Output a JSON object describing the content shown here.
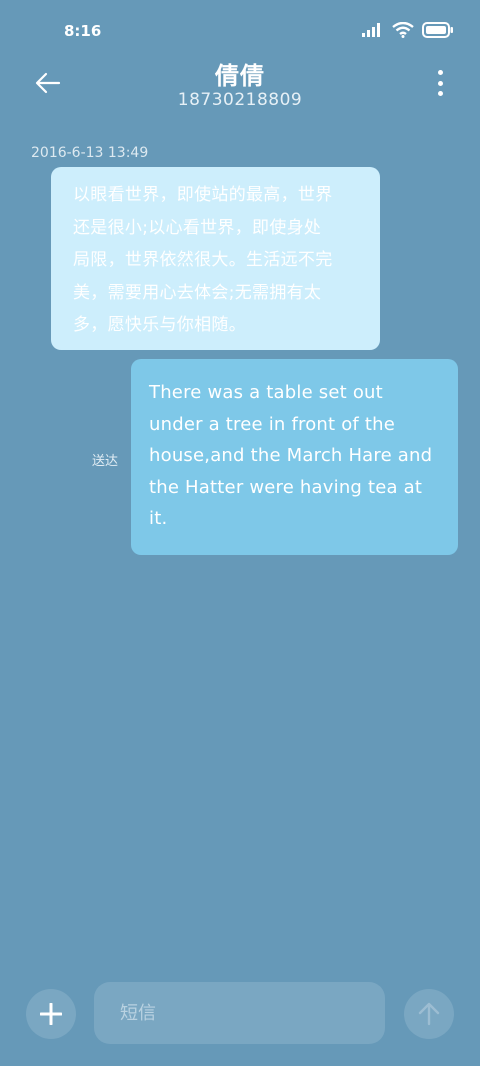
{
  "status_bar": {
    "time": "8:16",
    "icons": [
      "signal-icon",
      "wifi-icon",
      "battery-icon"
    ]
  },
  "header": {
    "contact_name": "倩倩",
    "phone_number": "18730218809",
    "back_icon": "arrow-left-icon",
    "more_icon": "more-vertical-icon"
  },
  "conversation": {
    "timestamp": "2016-6-13 13:49",
    "messages": [
      {
        "direction": "incoming",
        "text": "以眼看世界，即使站的最高，世界\n还是很小;以心看世界，即使身处\n局限，世界依然很大。生活远不完\n美，需要用心去体会;无需拥有太\n多，愿快乐与你相随。"
      },
      {
        "direction": "outgoing",
        "text": "There was a table set out\nunder a tree in front of the\nhouse,and the March Hare and\nthe Hatter were having tea at\nit.",
        "status": "送达"
      }
    ]
  },
  "input_bar": {
    "placeholder": "短信",
    "value": "",
    "add_icon": "plus-icon",
    "send_icon": "arrow-up-icon"
  },
  "colors": {
    "background": "#6699b8",
    "incoming_bubble": "#cdeefc",
    "outgoing_bubble": "#7ec8e8",
    "control": "#7aa7c2"
  }
}
